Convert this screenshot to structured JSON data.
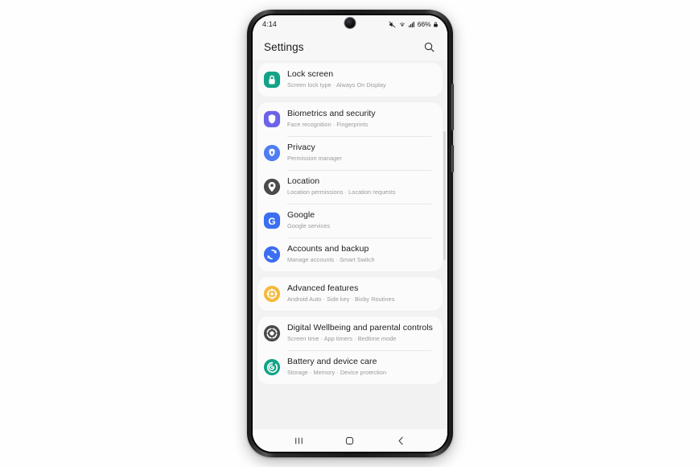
{
  "device": {
    "status_bar": {
      "time": "4:14",
      "battery_text": "66%",
      "icons": [
        "mute-icon",
        "wifi-icon",
        "signal-icon",
        "lock-icon"
      ]
    },
    "nav_bar": {
      "recents_label": "recents-icon",
      "home_label": "home-icon",
      "back_label": "back-icon"
    }
  },
  "app_bar": {
    "title": "Settings",
    "search_icon": "search-icon"
  },
  "settings": {
    "groups": [
      {
        "items": [
          {
            "id": "lock-screen",
            "title": "Lock screen",
            "subtitle": "Screen lock type  ·  Always On Display",
            "icon": "lock-icon",
            "icon_color": "#12a386"
          }
        ]
      },
      {
        "items": [
          {
            "id": "biometrics-and-security",
            "title": "Biometrics and security",
            "subtitle": "Face recognition  ·  Fingerprints",
            "icon": "shield-icon",
            "icon_color": "#6c63e8"
          },
          {
            "id": "privacy",
            "title": "Privacy",
            "subtitle": "Permission manager",
            "icon": "privacy-shield-icon",
            "icon_color": "#4f7df3"
          },
          {
            "id": "location",
            "title": "Location",
            "subtitle": "Location permissions  ·  Location requests",
            "icon": "location-pin-icon",
            "icon_color": "#4a4a4a"
          },
          {
            "id": "google",
            "title": "Google",
            "subtitle": "Google services",
            "icon": "google-g-icon",
            "icon_color": "#3b6ef0"
          },
          {
            "id": "accounts-and-backup",
            "title": "Accounts and backup",
            "subtitle": "Manage accounts  ·  Smart Switch",
            "icon": "sync-icon",
            "icon_color": "#3b6ef0"
          }
        ]
      },
      {
        "items": [
          {
            "id": "advanced-features",
            "title": "Advanced features",
            "subtitle": "Android Auto  ·  Side key  ·  Bixby Routines",
            "icon": "advanced-features-icon",
            "icon_color": "#f5b93c"
          }
        ]
      },
      {
        "items": [
          {
            "id": "digital-wellbeing",
            "title": "Digital Wellbeing and parental controls",
            "subtitle": "Screen time  ·  App timers  ·  Bedtime mode",
            "icon": "wellbeing-icon",
            "icon_color": "#4a4a4a"
          },
          {
            "id": "battery-and-device-care",
            "title": "Battery and device care",
            "subtitle": "Storage  ·  Memory  ·  Device protection",
            "icon": "device-care-icon",
            "icon_color": "#12a386"
          }
        ]
      }
    ]
  }
}
